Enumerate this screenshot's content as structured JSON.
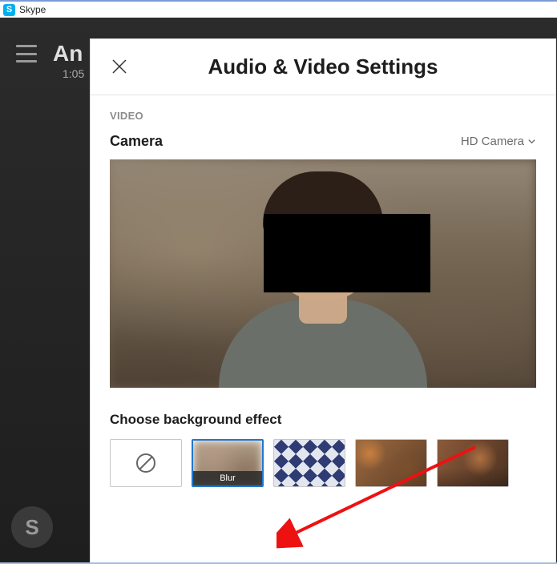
{
  "titlebar": {
    "app_name": "Skype"
  },
  "background": {
    "contact_initial": "An",
    "time": "1:05",
    "skype_letter": "S"
  },
  "panel": {
    "title": "Audio & Video Settings",
    "video_section_label": "VIDEO",
    "camera_label": "Camera",
    "camera_selected": "HD Camera",
    "choose_bg_label": "Choose background effect",
    "effects": {
      "none": "None",
      "blur": "Blur"
    }
  }
}
